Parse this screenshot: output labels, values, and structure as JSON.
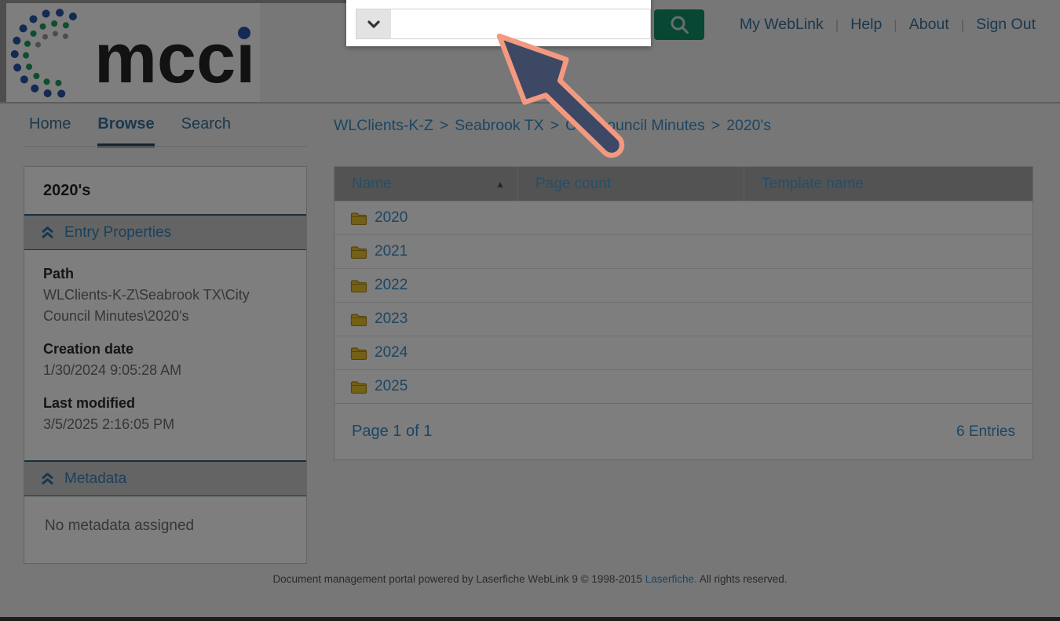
{
  "header": {
    "logo_text": "mcci",
    "nav_separator": "|",
    "nav_links": [
      {
        "label": "My WebLink"
      },
      {
        "label": "Help"
      },
      {
        "label": "About"
      },
      {
        "label": "Sign Out"
      }
    ],
    "search": {
      "input_value": "",
      "input_placeholder": ""
    }
  },
  "tabs": [
    {
      "label": "Home",
      "active": false
    },
    {
      "label": "Browse",
      "active": true
    },
    {
      "label": "Search",
      "active": false
    }
  ],
  "breadcrumb": {
    "separator": ">",
    "items": [
      {
        "label": "WLClients-K-Z"
      },
      {
        "label": "Seabrook TX"
      },
      {
        "label": "City Council Minutes"
      },
      {
        "label": "2020's"
      }
    ]
  },
  "sidebar": {
    "title": "2020's",
    "sections": [
      {
        "label": "Entry Properties",
        "fields": [
          {
            "label": "Path",
            "value": "WLClients-K-Z\\Seabrook TX\\City Council Minutes\\2020's"
          },
          {
            "label": "Creation date",
            "value": "1/30/2024 9:05:28 AM"
          },
          {
            "label": "Last modified",
            "value": "3/5/2025 2:16:05 PM"
          }
        ]
      },
      {
        "label": "Metadata",
        "empty_text": "No metadata assigned"
      }
    ]
  },
  "table": {
    "columns": [
      "Name",
      "Page count",
      "Template name"
    ],
    "sort": {
      "column": "Name",
      "direction": "asc"
    },
    "sort_icon": "▲",
    "rows": [
      {
        "name": "2020",
        "page_count": "",
        "template_name": ""
      },
      {
        "name": "2021",
        "page_count": "",
        "template_name": ""
      },
      {
        "name": "2022",
        "page_count": "",
        "template_name": ""
      },
      {
        "name": "2023",
        "page_count": "",
        "template_name": ""
      },
      {
        "name": "2024",
        "page_count": "",
        "template_name": ""
      },
      {
        "name": "2025",
        "page_count": "",
        "template_name": ""
      }
    ],
    "footer": {
      "page_text": "Page 1 of 1",
      "entries_text": "6 Entries"
    }
  },
  "page_footer": {
    "text": "Document management portal powered by Laserfiche WebLink 9 © 1998-2015",
    "link_label": "Laserfiche.",
    "suffix": "All rights reserved."
  },
  "annotation": {
    "type": "arrow",
    "points_at": "search-input"
  },
  "colors": {
    "link_blue": "#3a8ec9",
    "nav_blue": "#38719c",
    "search_green": "#13906b",
    "folder_yellow": "#eac430",
    "arrow_fill": "#3d4865",
    "arrow_outline": "#f2997f",
    "overlay": "rgba(0,0,0,0.505)"
  }
}
